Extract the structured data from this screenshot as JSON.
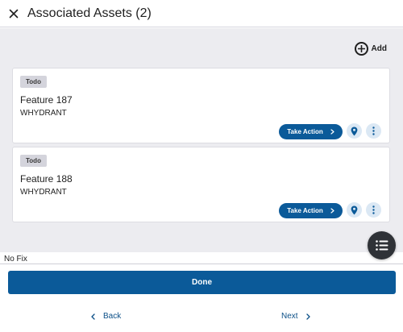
{
  "header": {
    "title": "Associated Assets (2)",
    "close_icon": "close-icon"
  },
  "toolbar": {
    "add_label": "Add",
    "add_icon": "plus-circle-icon"
  },
  "assets": [
    {
      "status": "Todo",
      "title": "Feature 187",
      "type": "WHYDRANT",
      "action_label": "Take Action"
    },
    {
      "status": "Todo",
      "title": "Feature 188",
      "type": "WHYDRANT",
      "action_label": "Take Action"
    }
  ],
  "footer": {
    "status_text": "No Fix",
    "done_label": "Done",
    "back_label": "Back",
    "next_label": "Next"
  },
  "colors": {
    "primary": "#0b5a99",
    "background": "#ececf0",
    "badge": "#d4d4dc",
    "fab": "#2f3237"
  }
}
